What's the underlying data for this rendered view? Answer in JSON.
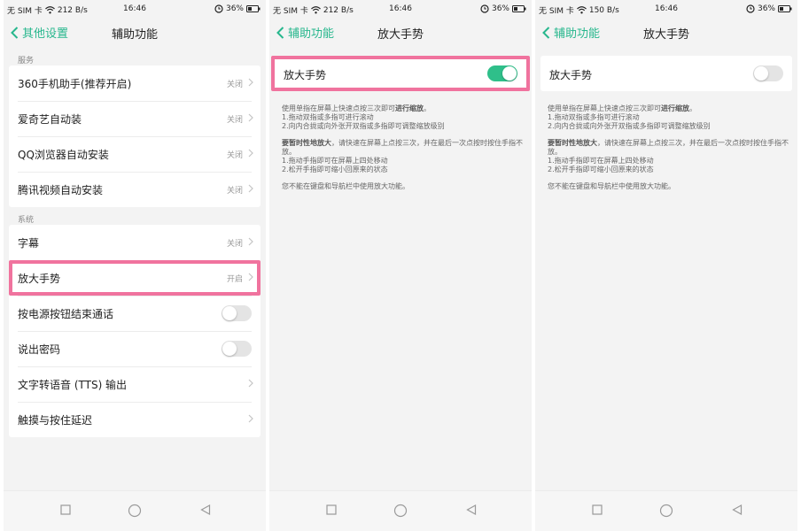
{
  "screens": [
    {
      "status": {
        "carrier": "无 SIM 卡",
        "speed": "212 B/s",
        "time": "16:46",
        "battery": "36%"
      },
      "header": {
        "back_label": "其他设置",
        "title": "辅助功能"
      },
      "sections": [
        {
          "label": "服务",
          "items": [
            {
              "label": "360手机助手(推荐开启)",
              "value": "关闭"
            },
            {
              "label": "爱奇艺自动装",
              "value": "关闭"
            },
            {
              "label": "QQ浏览器自动安装",
              "value": "关闭"
            },
            {
              "label": "腾讯视频自动安装",
              "value": "关闭"
            }
          ]
        },
        {
          "label": "系统",
          "items": [
            {
              "label": "字幕",
              "value": "关闭"
            },
            {
              "label": "放大手势",
              "value": "开启"
            },
            {
              "label": "按电源按钮结束通话",
              "toggle": false
            },
            {
              "label": "说出密码",
              "toggle": false
            },
            {
              "label": "文字转语音 (TTS) 输出"
            },
            {
              "label": "触摸与按住延迟"
            }
          ]
        }
      ]
    },
    {
      "status": {
        "carrier": "无 SIM 卡",
        "speed": "212 B/s",
        "time": "16:46",
        "battery": "36%"
      },
      "header": {
        "back_label": "辅助功能",
        "title": "放大手势"
      },
      "toggle_label": "放大手势",
      "toggle_on": true
    },
    {
      "status": {
        "carrier": "无 SIM 卡",
        "speed": "150 B/s",
        "time": "16:46",
        "battery": "36%"
      },
      "header": {
        "back_label": "辅助功能",
        "title": "放大手势"
      },
      "toggle_label": "放大手势",
      "toggle_on": false
    }
  ],
  "description": {
    "p1_pre": "使用单指在屏幕上快速点按三次即可",
    "p1_bold": "进行缩放",
    "p1_post": "。",
    "p1_l1": "1.拖动双指或多指可进行滚动",
    "p1_l2": "2.向内合拢或向外张开双指或多指即可调整缩放级别",
    "p2_bold": "要暂时性地放大",
    "p2_post": "，请快速在屏幕上点按三次，并在最后一次点按时按住手指不放。",
    "p2_l1": "1.拖动手指即可在屏幕上四处移动",
    "p2_l2": "2.松开手指即可缩小回原来的状态",
    "p3": "您不能在键盘和导航栏中使用放大功能。"
  },
  "colors": {
    "accent": "#27b78d",
    "toggle_on": "#2fbf8a",
    "highlight": "#f0739e"
  },
  "icons": {
    "back": "chevron-left-icon",
    "chevron": "chevron-right-icon",
    "nav": [
      "square-recents-icon",
      "circle-home-icon",
      "triangle-back-icon"
    ]
  }
}
